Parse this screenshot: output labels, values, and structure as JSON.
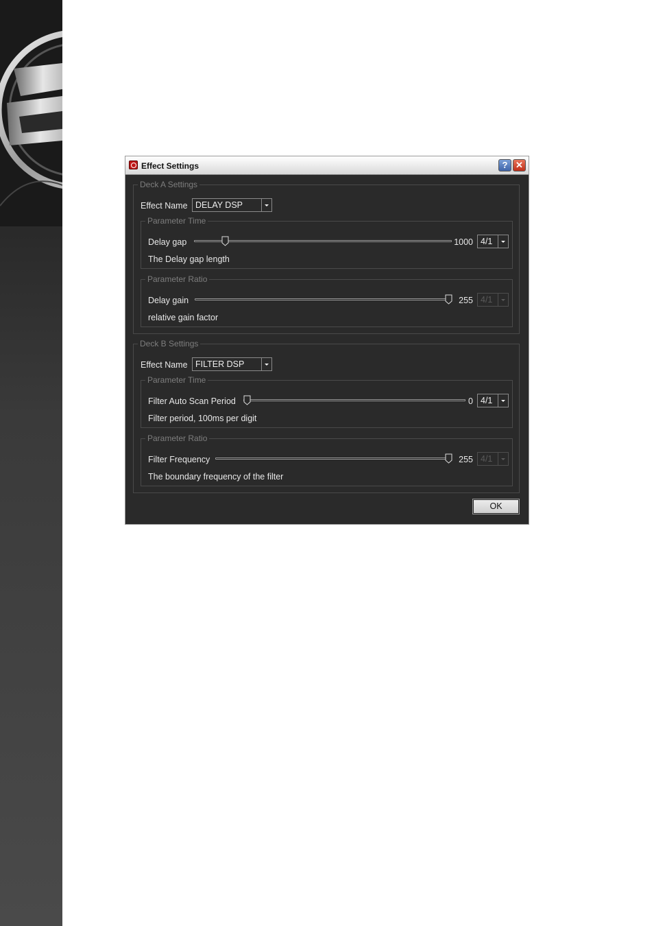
{
  "window": {
    "title": "Effect Settings",
    "help_label": "?",
    "close_label": "✕"
  },
  "deck_a": {
    "legend": "Deck A Settings",
    "effect_name_label": "Effect Name",
    "effect_name_value": "DELAY DSP",
    "time": {
      "legend": "Parameter Time",
      "label": "Delay gap",
      "value": "1000",
      "slider_fraction": 0.11,
      "unit": "4/1",
      "description": "The Delay gap length"
    },
    "ratio": {
      "legend": "Parameter Ratio",
      "label": "Delay gain",
      "value": "255",
      "slider_fraction": 1.0,
      "unit": "4/1",
      "unit_enabled": false,
      "description": "relative gain factor"
    }
  },
  "deck_b": {
    "legend": "Deck B Settings",
    "effect_name_label": "Effect Name",
    "effect_name_value": "FILTER DSP",
    "time": {
      "legend": "Parameter Time",
      "label": "Filter Auto Scan Period",
      "value": "0",
      "slider_fraction": 0.0,
      "unit": "4/1",
      "description": "Filter period, 100ms per digit"
    },
    "ratio": {
      "legend": "Parameter Ratio",
      "label": "Filter Frequency",
      "value": "255",
      "slider_fraction": 1.0,
      "unit": "4/1",
      "unit_enabled": false,
      "description": "The boundary frequency of the filter"
    }
  },
  "footer": {
    "ok_label": "OK"
  },
  "colors": {
    "dialog_bg": "#2a2a2a",
    "text": "#e8e8e8",
    "legend_text": "#7e7e7e"
  }
}
